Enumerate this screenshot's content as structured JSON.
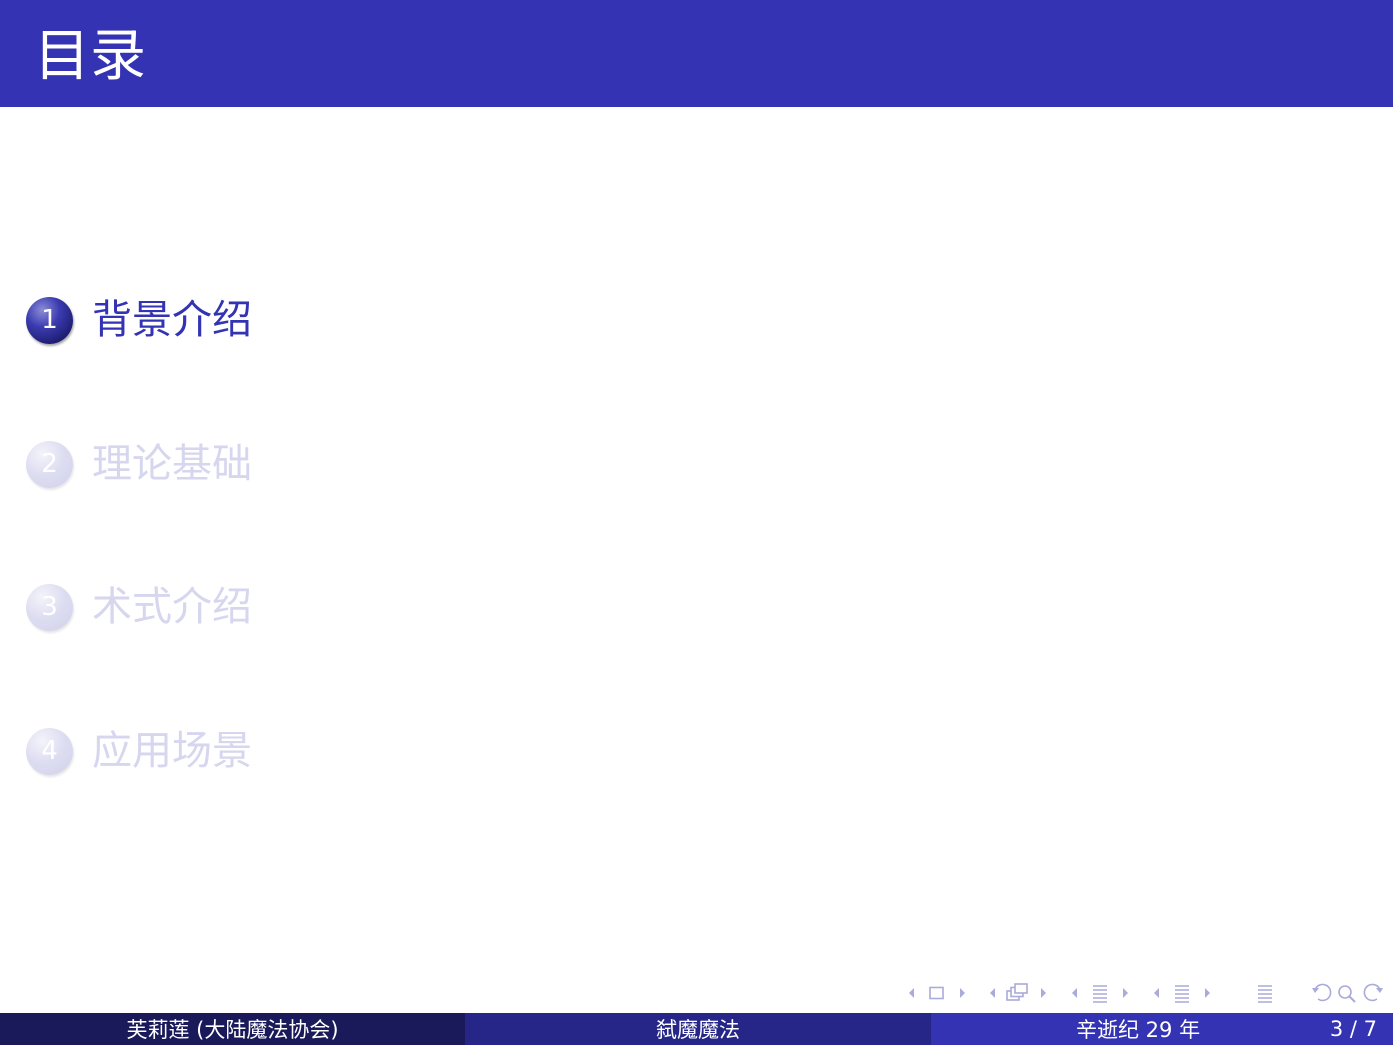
{
  "header": {
    "title": "目录"
  },
  "toc": {
    "items": [
      {
        "number": "1",
        "label": "背景介绍",
        "active": true
      },
      {
        "number": "2",
        "label": "理论基础",
        "active": false
      },
      {
        "number": "3",
        "label": "术式介绍",
        "active": false
      },
      {
        "number": "4",
        "label": "应用场景",
        "active": false
      }
    ]
  },
  "navigation": {
    "icons": [
      "nav-frame-icon",
      "nav-subsection-icon",
      "nav-section-icon",
      "nav-document-icon",
      "nav-align-icon",
      "nav-back-icon",
      "nav-search-icon",
      "nav-forward-icon"
    ]
  },
  "footer": {
    "author": "芙莉莲 (大陆魔法协会)",
    "title": "弑魔魔法",
    "date": "辛逝纪 29 年",
    "page": "3 / 7"
  },
  "colors": {
    "header_bg": "#3333b3",
    "active_text": "#3333b3",
    "inactive_text": "#d6d6ef",
    "footer_left": "#1a1a5a",
    "footer_middle": "#262688",
    "footer_right": "#3333b3",
    "nav_icons": "#aaaadb"
  }
}
